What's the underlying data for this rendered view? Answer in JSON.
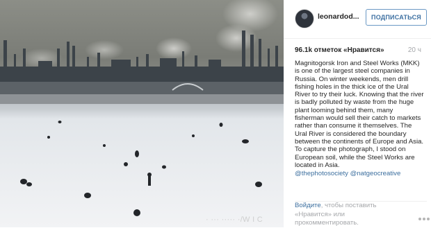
{
  "post": {
    "username": "leonardod...",
    "follow_label": "ПОДПИСАТЬСЯ",
    "likes": "96.1k отметок «Нравится»",
    "time_ago": "20 ч",
    "caption": "Magnitogorsk Iron and Steel Works (MKK) is one of the largest steel companies in Russia. On winter weekends, men drill fishing holes in the thick ice of the Ural River to try their luck. Knowing that the river is badly polluted by waste from the huge plant looming behind them, many fisherman would sell their catch to markets rather than consume it themselves. The Ural River is considered the boundary between the continents of Europe and Asia. To capture the photograph, I stood on European soil, while the Steel Works are located in Asia.",
    "mentions": "@thephotosociety @natgeocreative",
    "login_link": "Войдите",
    "login_text": ", чтобы поставить «Нравится» или прокомментировать."
  },
  "photo": {
    "watermark": "· ··· ····· ·/W I C",
    "sky_color": "#7b7d78",
    "ice_color": "#e9ecef",
    "factory_color": "#3a4147"
  },
  "icons": {
    "avatar": "profile-avatar",
    "more": "more-options-icon"
  }
}
